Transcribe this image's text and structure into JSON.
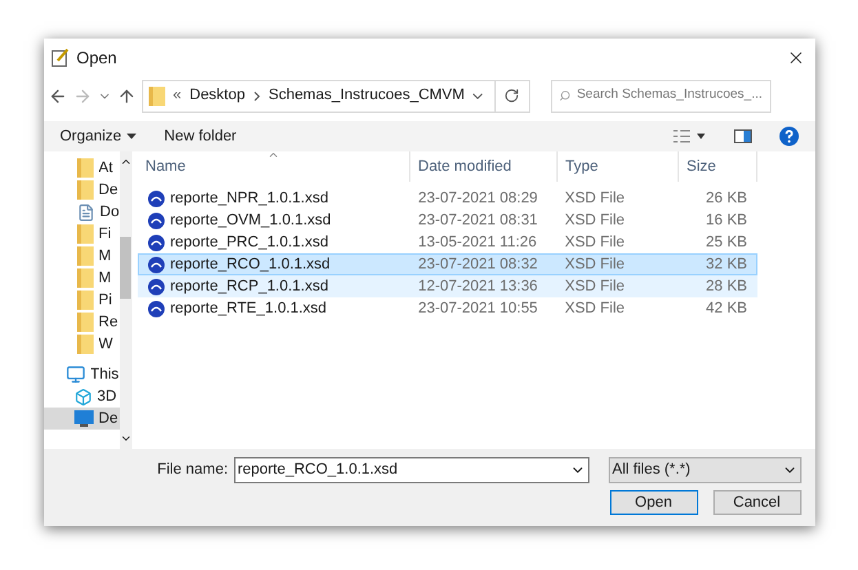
{
  "window": {
    "title": "Open"
  },
  "address": {
    "overflow": "«",
    "crumbs": [
      "Desktop",
      "Schemas_Instrucoes_CMVM"
    ]
  },
  "search": {
    "placeholder": "Search Schemas_Instrucoes_..."
  },
  "toolbar": {
    "organize": "Organize",
    "new_folder": "New folder"
  },
  "sidebar": {
    "items": [
      {
        "label": "At",
        "kind": "folder",
        "selected": false
      },
      {
        "label": "De",
        "kind": "folder",
        "selected": false
      },
      {
        "label": "Do",
        "kind": "document",
        "selected": false
      },
      {
        "label": "Fi",
        "kind": "folder",
        "selected": false
      },
      {
        "label": "M",
        "kind": "folder",
        "selected": false
      },
      {
        "label": "M",
        "kind": "folder",
        "selected": false
      },
      {
        "label": "Pi",
        "kind": "folder",
        "selected": false
      },
      {
        "label": "Re",
        "kind": "folder",
        "selected": false
      },
      {
        "label": "W",
        "kind": "folder",
        "selected": false
      },
      {
        "label": "This",
        "kind": "computer",
        "selected": false
      },
      {
        "label": "3D",
        "kind": "cube",
        "selected": false
      },
      {
        "label": "De",
        "kind": "desktop",
        "selected": true
      }
    ]
  },
  "table": {
    "columns": [
      "Name",
      "Date modified",
      "Type",
      "Size"
    ],
    "rows": [
      {
        "name": "reporte_NPR_1.0.1.xsd",
        "date": "23-07-2021 08:29",
        "type": "XSD File",
        "size": "26 KB",
        "selected": false,
        "hovered": false
      },
      {
        "name": "reporte_OVM_1.0.1.xsd",
        "date": "23-07-2021 08:31",
        "type": "XSD File",
        "size": "16 KB",
        "selected": false,
        "hovered": false
      },
      {
        "name": "reporte_PRC_1.0.1.xsd",
        "date": "13-05-2021 11:26",
        "type": "XSD File",
        "size": "25 KB",
        "selected": false,
        "hovered": false
      },
      {
        "name": "reporte_RCO_1.0.1.xsd",
        "date": "23-07-2021 08:32",
        "type": "XSD File",
        "size": "32 KB",
        "selected": true,
        "hovered": false
      },
      {
        "name": "reporte_RCP_1.0.1.xsd",
        "date": "12-07-2021 13:36",
        "type": "XSD File",
        "size": "28 KB",
        "selected": false,
        "hovered": true
      },
      {
        "name": "reporte_RTE_1.0.1.xsd",
        "date": "23-07-2021 10:55",
        "type": "XSD File",
        "size": "42 KB",
        "selected": false,
        "hovered": false
      }
    ]
  },
  "footer": {
    "file_name_label": "File name:",
    "file_name_value": "reporte_RCO_1.0.1.xsd",
    "filter": "All files (*.*)",
    "buttons": [
      "Open",
      "Cancel"
    ]
  }
}
